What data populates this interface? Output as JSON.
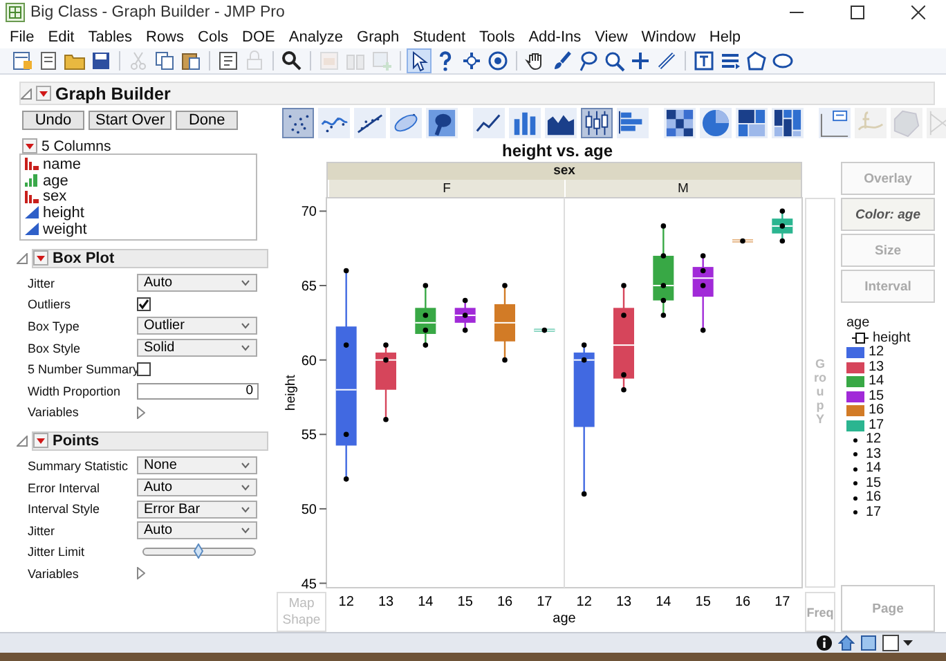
{
  "window": {
    "title": "Big Class - Graph Builder - JMP Pro"
  },
  "menu": [
    "File",
    "Edit",
    "Tables",
    "Rows",
    "Cols",
    "DOE",
    "Analyze",
    "Graph",
    "Student",
    "Tools",
    "Add-Ins",
    "View",
    "Window",
    "Help"
  ],
  "toolbar": [
    {
      "kind": "new-table",
      "disabled": false,
      "selected": false
    },
    {
      "kind": "new-script",
      "disabled": false,
      "selected": false
    },
    {
      "kind": "folder",
      "disabled": false,
      "selected": false
    },
    {
      "kind": "disk",
      "disabled": false,
      "selected": false
    },
    {
      "kind": "scissors",
      "disabled": true,
      "selected": false
    },
    {
      "kind": "copy",
      "disabled": false,
      "selected": false
    },
    {
      "kind": "paste",
      "disabled": false,
      "selected": false
    },
    {
      "kind": "script-window",
      "disabled": false,
      "selected": false
    },
    {
      "kind": "padlock",
      "disabled": true,
      "selected": false
    },
    {
      "kind": "search",
      "disabled": false,
      "selected": false
    },
    {
      "kind": "chart-page",
      "disabled": true,
      "selected": false
    },
    {
      "kind": "binoculars",
      "disabled": true,
      "selected": false
    },
    {
      "kind": "chart-add",
      "disabled": true,
      "selected": false
    },
    {
      "kind": "arrow-pointer",
      "disabled": false,
      "selected": true
    },
    {
      "kind": "question-mark",
      "disabled": false,
      "selected": false
    },
    {
      "kind": "crosshair",
      "disabled": false,
      "selected": false
    },
    {
      "kind": "target",
      "disabled": false,
      "selected": false
    },
    {
      "kind": "hand",
      "disabled": false,
      "selected": false
    },
    {
      "kind": "brush",
      "disabled": false,
      "selected": false
    },
    {
      "kind": "lasso",
      "disabled": false,
      "selected": false
    },
    {
      "kind": "zoom",
      "disabled": false,
      "selected": false
    },
    {
      "kind": "plus",
      "disabled": false,
      "selected": false
    },
    {
      "kind": "ruler",
      "disabled": false,
      "selected": false
    },
    {
      "kind": "text-box",
      "disabled": false,
      "selected": false
    },
    {
      "kind": "lines",
      "disabled": false,
      "selected": false
    },
    {
      "kind": "polygon",
      "disabled": false,
      "selected": false
    },
    {
      "kind": "ellipse",
      "disabled": false,
      "selected": false
    }
  ],
  "graph_builder": {
    "title": "Graph Builder",
    "buttons": [
      "Undo",
      "Start Over",
      "Done"
    ],
    "columns_header": "5 Columns",
    "columns": [
      {
        "name": "name",
        "kind": "nominal"
      },
      {
        "name": "age",
        "kind": "ordinal"
      },
      {
        "name": "sex",
        "kind": "nominal"
      },
      {
        "name": "height",
        "kind": "continuous"
      },
      {
        "name": "weight",
        "kind": "continuous"
      }
    ]
  },
  "sections": [
    {
      "title": "Box Plot",
      "rows": [
        {
          "label": "Jitter",
          "kind": "dropdown",
          "value": "Auto"
        },
        {
          "label": "Outliers",
          "kind": "checkbox",
          "checked": true
        },
        {
          "label": "Box Type",
          "kind": "dropdown",
          "value": "Outlier"
        },
        {
          "label": "Box Style",
          "kind": "dropdown",
          "value": "Solid"
        },
        {
          "label": "5 Number Summary",
          "kind": "checkbox",
          "checked": false
        },
        {
          "label": "Width Proportion",
          "kind": "number",
          "value": "0"
        },
        {
          "label": "Variables",
          "kind": "disclosure"
        }
      ]
    },
    {
      "title": "Points",
      "rows": [
        {
          "label": "Summary Statistic",
          "kind": "dropdown",
          "value": "None"
        },
        {
          "label": "Error Interval",
          "kind": "dropdown",
          "value": "Auto"
        },
        {
          "label": "Interval Style",
          "kind": "dropdown",
          "value": "Error Bar"
        },
        {
          "label": "Jitter",
          "kind": "dropdown",
          "value": "Auto"
        },
        {
          "label": "Jitter Limit",
          "kind": "slider",
          "level": 0.5
        },
        {
          "label": "Variables",
          "kind": "disclosure"
        }
      ]
    }
  ],
  "graph_elements": [
    {
      "kind": "points",
      "selected": true,
      "disabled": false
    },
    {
      "kind": "smoother",
      "selected": false,
      "disabled": false
    },
    {
      "kind": "line-of-fit",
      "selected": false,
      "disabled": false
    },
    {
      "kind": "ellipse",
      "selected": false,
      "disabled": false
    },
    {
      "kind": "contour",
      "selected": false,
      "disabled": false
    },
    {
      "kind": "line",
      "selected": false,
      "disabled": false
    },
    {
      "kind": "bar",
      "selected": false,
      "disabled": false
    },
    {
      "kind": "area",
      "selected": false,
      "disabled": false
    },
    {
      "kind": "box-plot",
      "selected": true,
      "disabled": false
    },
    {
      "kind": "histogram",
      "selected": false,
      "disabled": false
    },
    {
      "kind": "heatmap",
      "selected": false,
      "disabled": false
    },
    {
      "kind": "pie",
      "selected": false,
      "disabled": false
    },
    {
      "kind": "treemap",
      "selected": false,
      "disabled": false
    },
    {
      "kind": "mosaic",
      "selected": false,
      "disabled": false
    },
    {
      "kind": "caption-box",
      "selected": false,
      "disabled": false
    },
    {
      "kind": "formula",
      "selected": false,
      "disabled": true
    },
    {
      "kind": "map-shape",
      "selected": false,
      "disabled": true
    },
    {
      "kind": "parallel",
      "selected": false,
      "disabled": true
    }
  ],
  "graph": {
    "title": "height vs. age",
    "group_x": {
      "title": "sex",
      "levels": [
        "F",
        "M"
      ]
    },
    "chart_data": {
      "type": "scatter",
      "xlabel": "age",
      "ylabel": "height",
      "ylim": [
        44.7,
        70.9
      ],
      "yticks": [
        45,
        50,
        55,
        60,
        65,
        70
      ],
      "categories": [
        "12",
        "13",
        "14",
        "15",
        "16",
        "17",
        "12",
        "13",
        "14",
        "15",
        "16",
        "17"
      ],
      "series": [
        {
          "color": "#000000",
          "values": [
            52,
            56,
            61,
            62,
            60,
            62,
            51,
            58,
            63,
            62,
            68,
            68
          ]
        },
        {
          "color": "#000000",
          "values": [
            55,
            60,
            62,
            63,
            65,
            null,
            60,
            59,
            64,
            65,
            null,
            69
          ]
        },
        {
          "color": "#000000",
          "values": [
            61,
            61,
            63,
            64,
            null,
            null,
            61,
            63,
            65,
            66,
            null,
            70
          ]
        },
        {
          "color": "#000000",
          "values": [
            66,
            null,
            65,
            null,
            null,
            null,
            null,
            65,
            67,
            67,
            null,
            null
          ]
        },
        {
          "color": "#000000",
          "values": [
            null,
            null,
            null,
            null,
            null,
            null,
            null,
            null,
            69,
            null,
            null,
            null
          ]
        }
      ]
    }
  },
  "drop_zones": {
    "group_y": "Group Y",
    "map_shape": "Map Shape",
    "freq": "Freq",
    "page": "Page",
    "right": [
      {
        "label": "Overlay",
        "active": false
      },
      {
        "label": "Color: age",
        "active": true
      },
      {
        "label": "Size",
        "active": false
      },
      {
        "label": "Interval",
        "active": false
      }
    ]
  },
  "legend": {
    "title": "age",
    "box_label": "height",
    "boxes": [
      {
        "label": "12",
        "color": "#4169e1"
      },
      {
        "label": "13",
        "color": "#d6455b"
      },
      {
        "label": "14",
        "color": "#38a845"
      },
      {
        "label": "15",
        "color": "#a12ad8"
      },
      {
        "label": "16",
        "color": "#d27b26"
      },
      {
        "label": "17",
        "color": "#2bb590"
      }
    ],
    "points": [
      "12",
      "13",
      "14",
      "15",
      "16",
      "17"
    ]
  }
}
